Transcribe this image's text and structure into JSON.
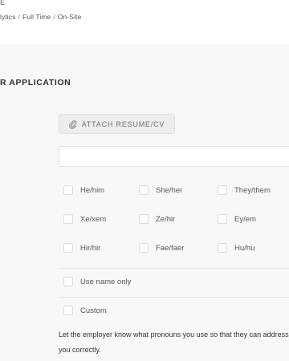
{
  "header": {
    "top_fragment": "E",
    "breadcrumb": [
      "lytics",
      "Full Time",
      "On-Site"
    ],
    "separator": "/"
  },
  "section": {
    "title": "R APPLICATION"
  },
  "form": {
    "attach_label": "ATTACH RESUME/CV",
    "attach_icon": "paperclip-icon",
    "name_input_value": "",
    "pronouns": {
      "row1": [
        "He/him",
        "She/her",
        "They/them"
      ],
      "row2": [
        "Xe/xem",
        "Ze/hir",
        "Ey/em"
      ],
      "row3": [
        "Hir/hir",
        "Fae/faer",
        "Hu/hu"
      ],
      "use_name_only": "Use name only",
      "custom": "Custom"
    },
    "help_text": "Let the employer know what pronouns you use so that they can address you correctly."
  },
  "colors": {
    "page_background": "#f8f8f8",
    "button_background": "#ededed",
    "text": "#333333"
  }
}
